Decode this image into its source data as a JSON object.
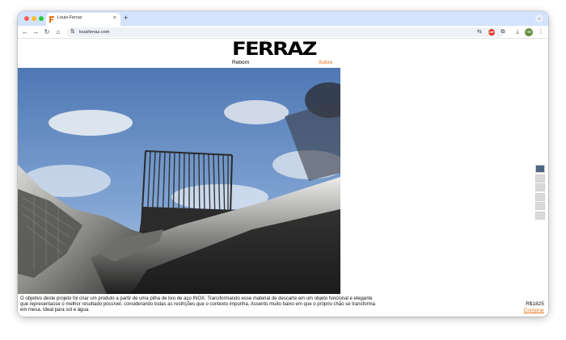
{
  "browser": {
    "tab": {
      "title": "Louis Ferraz",
      "close_glyph": "×"
    },
    "new_tab_glyph": "+",
    "tab_menu_glyph": "⌄",
    "nav": {
      "back_glyph": "←",
      "forward_glyph": "→",
      "reload_glyph": "↻",
      "home_glyph": "⌂"
    },
    "address": {
      "url": "louisferraz.com",
      "tune_glyph": "⇅"
    },
    "toolbar": {
      "translate_glyph": "⇆",
      "bookmark_glyph": "☆",
      "extension_badge": "ABP",
      "extensions_glyph": "⧉",
      "download_glyph": "⤓",
      "avatar_initials": "HB",
      "menu_glyph": "⋮"
    }
  },
  "site": {
    "logo": "FERRAZ",
    "nav": {
      "left": "Reborn",
      "right": "Sobre"
    },
    "description": "O objetivo deste projeto foi criar um produto a partir de uma pilha de lixo de aço INOX. Transformando esse material de descarte em um objeto funcional e elegante que representasse o melhor resultado possível, considerando todas as restrições que o contexto impunha. Assento muito baixo em que o próprio chão se transforma em mesa. Ideal para sol e água.",
    "price": "R$1825",
    "buy_label": "Comprar",
    "thumbnails": [
      "thumb-1",
      "thumb-2",
      "thumb-3",
      "thumb-4",
      "thumb-5",
      "thumb-6"
    ]
  },
  "colors": {
    "tabstrip": "#d3e3fd",
    "accent_orange": "#e8731b",
    "sky": "#6f93c6"
  }
}
